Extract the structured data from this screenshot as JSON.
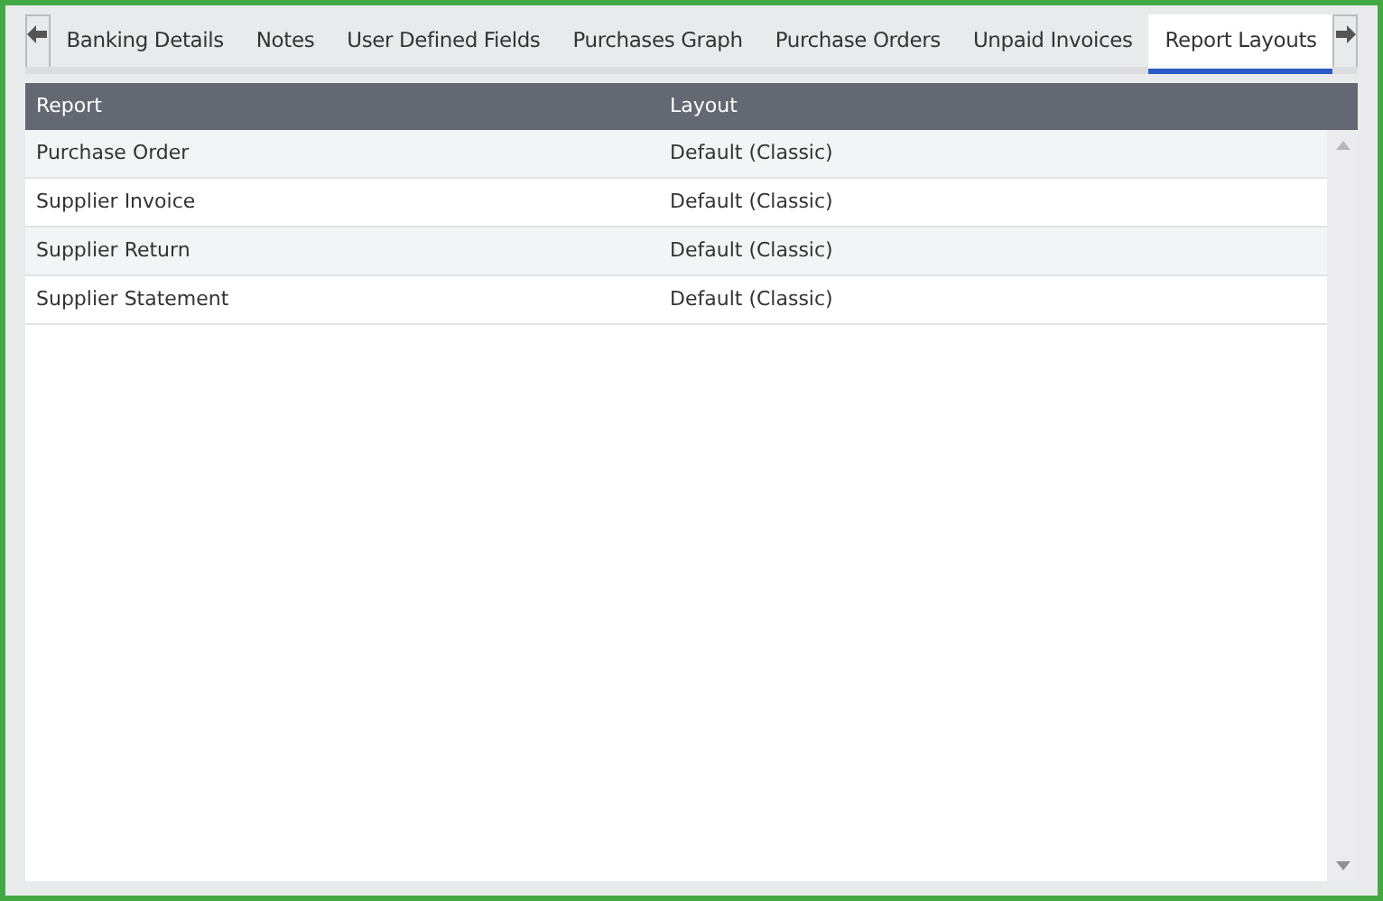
{
  "tabs": [
    {
      "label": "Banking Details",
      "selected": false
    },
    {
      "label": "Notes",
      "selected": false
    },
    {
      "label": "User Defined Fields",
      "selected": false
    },
    {
      "label": "Purchases Graph",
      "selected": false
    },
    {
      "label": "Purchase Orders",
      "selected": false
    },
    {
      "label": "Unpaid Invoices",
      "selected": false
    },
    {
      "label": "Report Layouts",
      "selected": true
    }
  ],
  "table": {
    "columns": [
      "Report",
      "Layout"
    ],
    "rows": [
      {
        "cells": [
          "Purchase Order",
          "Default (Classic)"
        ]
      },
      {
        "cells": [
          "Supplier Invoice",
          "Default (Classic)"
        ]
      },
      {
        "cells": [
          "Supplier Return",
          "Default (Classic)"
        ]
      },
      {
        "cells": [
          "Supplier Statement",
          "Default (Classic)"
        ]
      }
    ]
  }
}
